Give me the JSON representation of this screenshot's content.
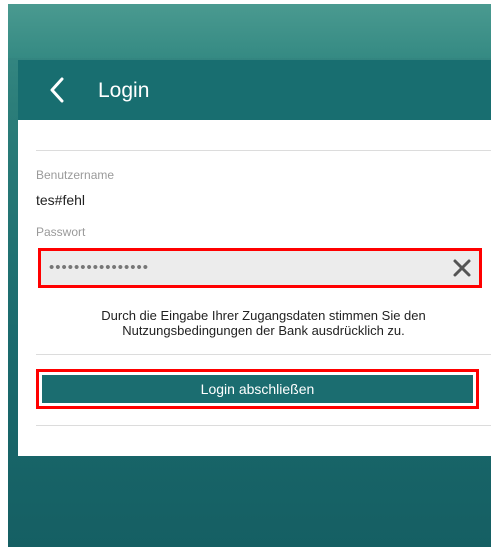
{
  "header": {
    "title": "Login",
    "back_icon": "chevron-left-icon"
  },
  "form": {
    "username": {
      "label": "Benutzername",
      "value": "tes#fehl"
    },
    "password": {
      "label": "Passwort",
      "masked_value": "••••••••••••••••",
      "clear_icon": "close-icon"
    },
    "terms_line1": "Durch die Eingabe Ihrer Zugangsdaten stimmen Sie den",
    "terms_line2": "Nutzungsbedingungen der Bank ausdrücklich zu.",
    "submit_label": "Login abschließen"
  },
  "colors": {
    "brand": "#1b6d70",
    "highlight": "#ff0000"
  }
}
